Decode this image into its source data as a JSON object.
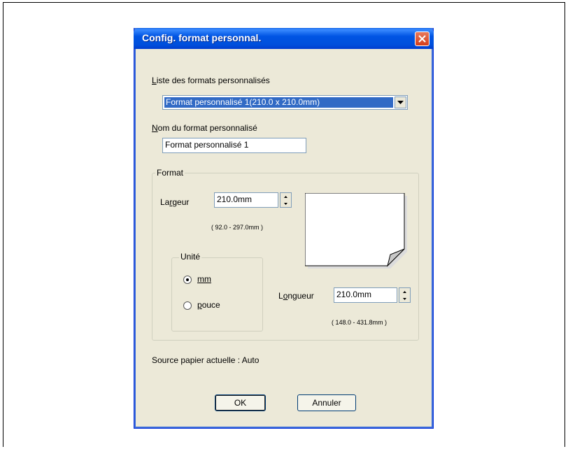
{
  "dialog": {
    "title": "Config. format personnal.",
    "list_label_underline": "L",
    "list_label_rest": "iste des formats personnalisés",
    "selected_format": "Format personnalisé 1(210.0 x 210.0mm)",
    "name_label_underline": "N",
    "name_label_rest": "om du format personnalisé",
    "name_value": "Format personnalisé 1",
    "format_group": {
      "title": "Format",
      "width_label_pre": "La",
      "width_label_underline": "r",
      "width_label_post": "geur",
      "width_value": "210.0mm",
      "width_range": "( 92.0 - 297.0mm )",
      "length_label_pre": "L",
      "length_label_underline": "o",
      "length_label_post": "ngueur",
      "length_value": "210.0mm",
      "length_range": "( 148.0 - 431.8mm )"
    },
    "unit_group": {
      "title": "Unité",
      "option_mm": "mm",
      "option_mm_selected": true,
      "option_pouce": "pouce"
    },
    "paper_source": "Source papier actuelle : Auto",
    "ok_label": "OK",
    "cancel_label": "Annuler"
  }
}
